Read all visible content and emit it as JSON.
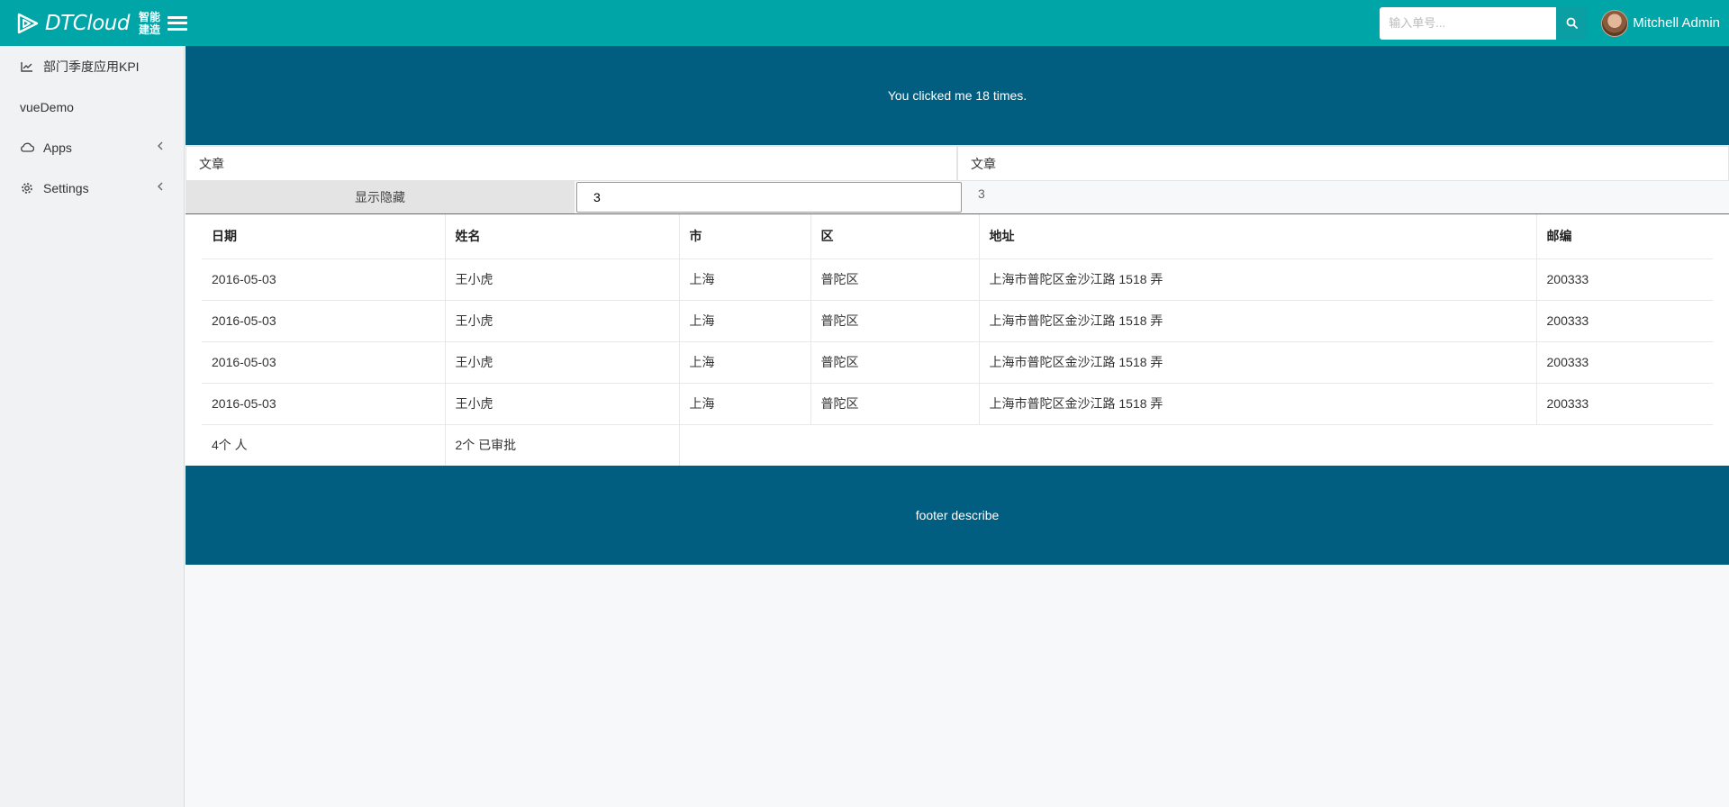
{
  "brand": {
    "name": "DTCloud",
    "sub_top": "智能",
    "sub_bottom": "建造"
  },
  "search": {
    "placeholder": "输入单号..."
  },
  "user": {
    "name": "Mitchell Admin"
  },
  "sidebar": {
    "items": [
      {
        "label": "部门季度应用KPI",
        "icon": "line-chart-icon"
      },
      {
        "label": "vueDemo"
      },
      {
        "label": "Apps",
        "icon": "cloud-icon"
      },
      {
        "label": "Settings",
        "icon": "gear-icon"
      }
    ]
  },
  "hero": {
    "text": "You clicked me 18 times."
  },
  "columns": {
    "left": "文章",
    "right": "文章"
  },
  "toggle": {
    "button_label": "显示隐藏",
    "input_value": "3",
    "display_value": "3"
  },
  "table": {
    "headers": [
      "日期",
      "姓名",
      "市",
      "区",
      "地址",
      "邮编"
    ],
    "rows": [
      [
        "2016-05-03",
        "王小虎",
        "上海",
        "普陀区",
        "上海市普陀区金沙江路 1518 弄",
        "200333"
      ],
      [
        "2016-05-03",
        "王小虎",
        "上海",
        "普陀区",
        "上海市普陀区金沙江路 1518 弄",
        "200333"
      ],
      [
        "2016-05-03",
        "王小虎",
        "上海",
        "普陀区",
        "上海市普陀区金沙江路 1518 弄",
        "200333"
      ],
      [
        "2016-05-03",
        "王小虎",
        "上海",
        "普陀区",
        "上海市普陀区金沙江路 1518 弄",
        "200333"
      ]
    ],
    "summary": [
      "4个 人",
      "2个 已审批"
    ]
  },
  "footer": {
    "text": "footer describe"
  },
  "colors": {
    "navbar": "#00a5a8",
    "banner": "#025e80",
    "table_top_border": "#ee3333"
  }
}
